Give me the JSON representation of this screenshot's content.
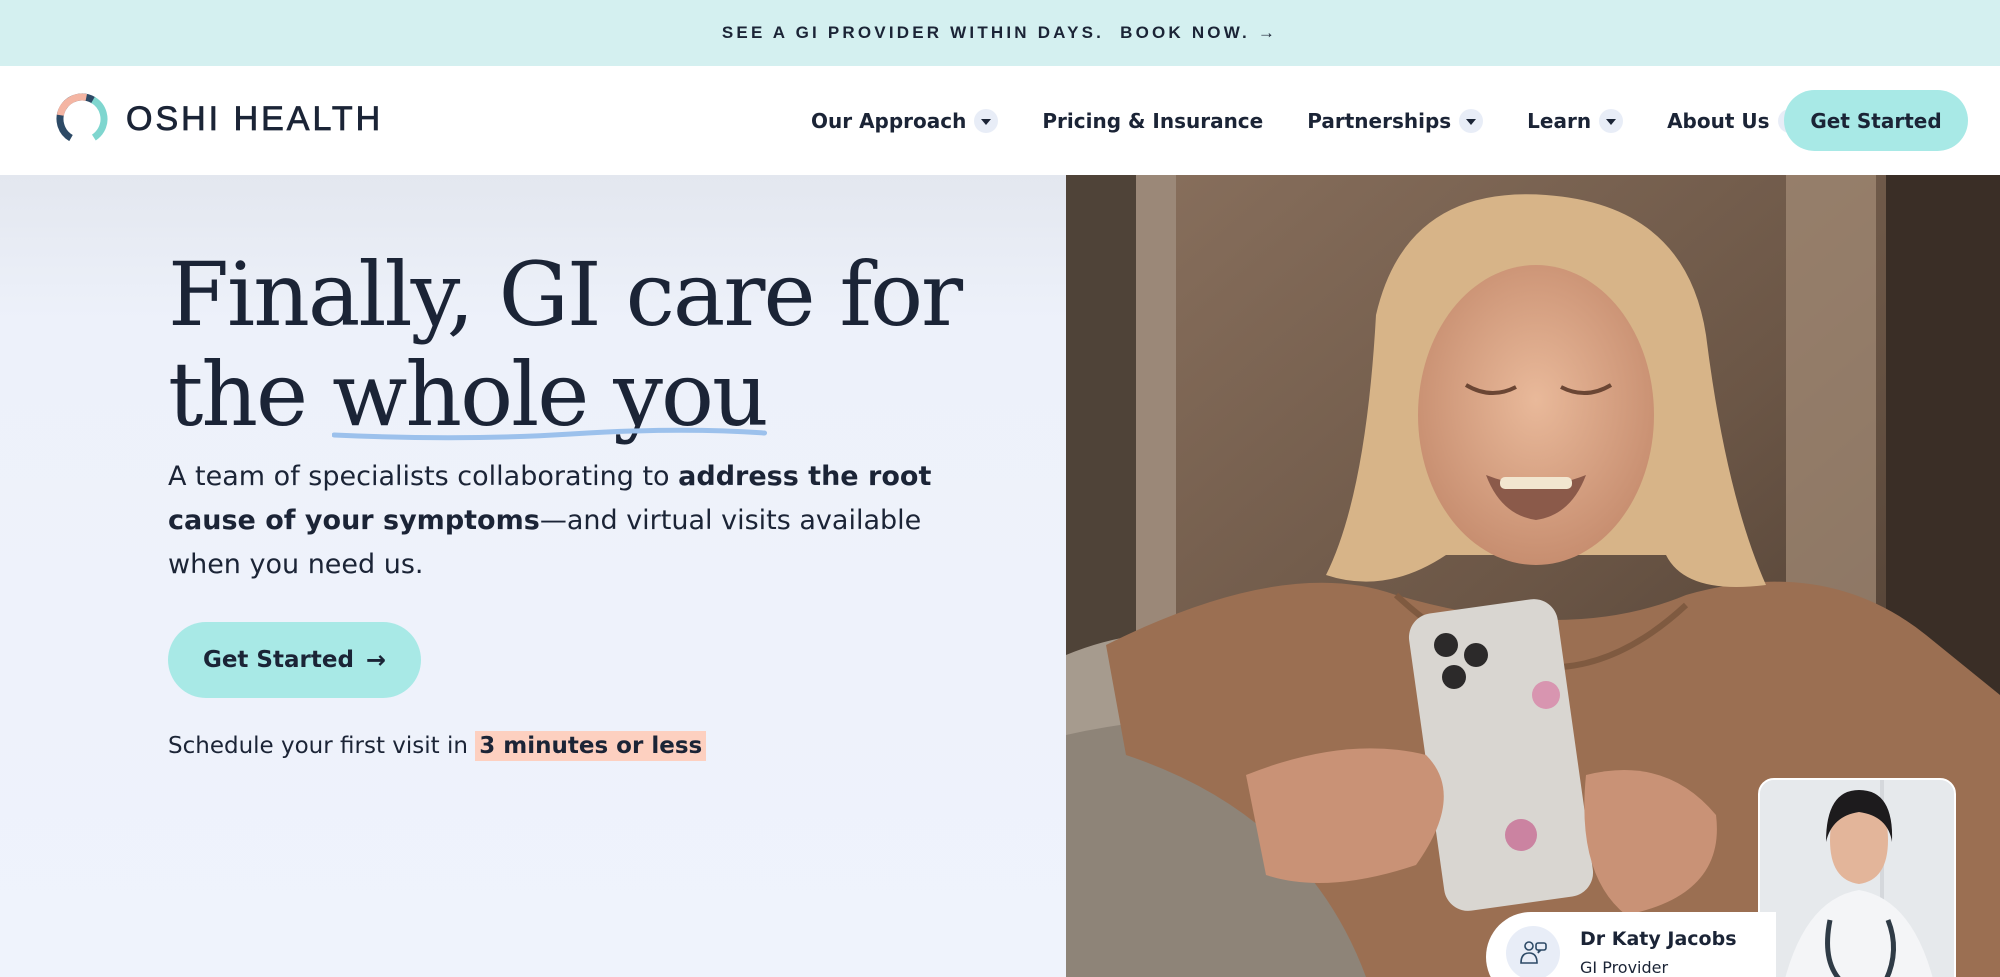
{
  "announcement": {
    "text": "SEE A GI PROVIDER WITHIN DAYS.",
    "cta": "BOOK NOW. →"
  },
  "header": {
    "logo_text": "OSHI HEALTH",
    "nav": [
      {
        "label": "Our Approach",
        "has_dropdown": true
      },
      {
        "label": "Pricing & Insurance",
        "has_dropdown": false
      },
      {
        "label": "Partnerships",
        "has_dropdown": true
      },
      {
        "label": "Learn",
        "has_dropdown": true
      },
      {
        "label": "About Us",
        "has_dropdown": true
      }
    ],
    "cta_label": "Get Started"
  },
  "hero": {
    "headline_part1": "Finally, GI care for",
    "headline_part2": "the",
    "headline_underlined": "whole you",
    "sub_part1": "A team of specialists collaborating to",
    "sub_bold": "address the root cause of your symptoms",
    "sub_part2": "—and virtual visits available when you need us.",
    "cta_label": "Get Started",
    "cta_icon": "arrow-right-icon",
    "schedule_text": "Schedule your first visit in",
    "schedule_highlight": "3 minutes or less"
  },
  "provider_card": {
    "name": "Dr Katy Jacobs",
    "role": "GI Provider",
    "icon": "doctor-chat-icon"
  },
  "colors": {
    "announcement_bg": "#d4f0f0",
    "button_teal": "#a8e9e6",
    "hero_bg": "#eff3fc",
    "text_navy": "#1b2436",
    "highlight_peach": "#fdd0c0",
    "underline_blue": "#9cc1ec"
  }
}
